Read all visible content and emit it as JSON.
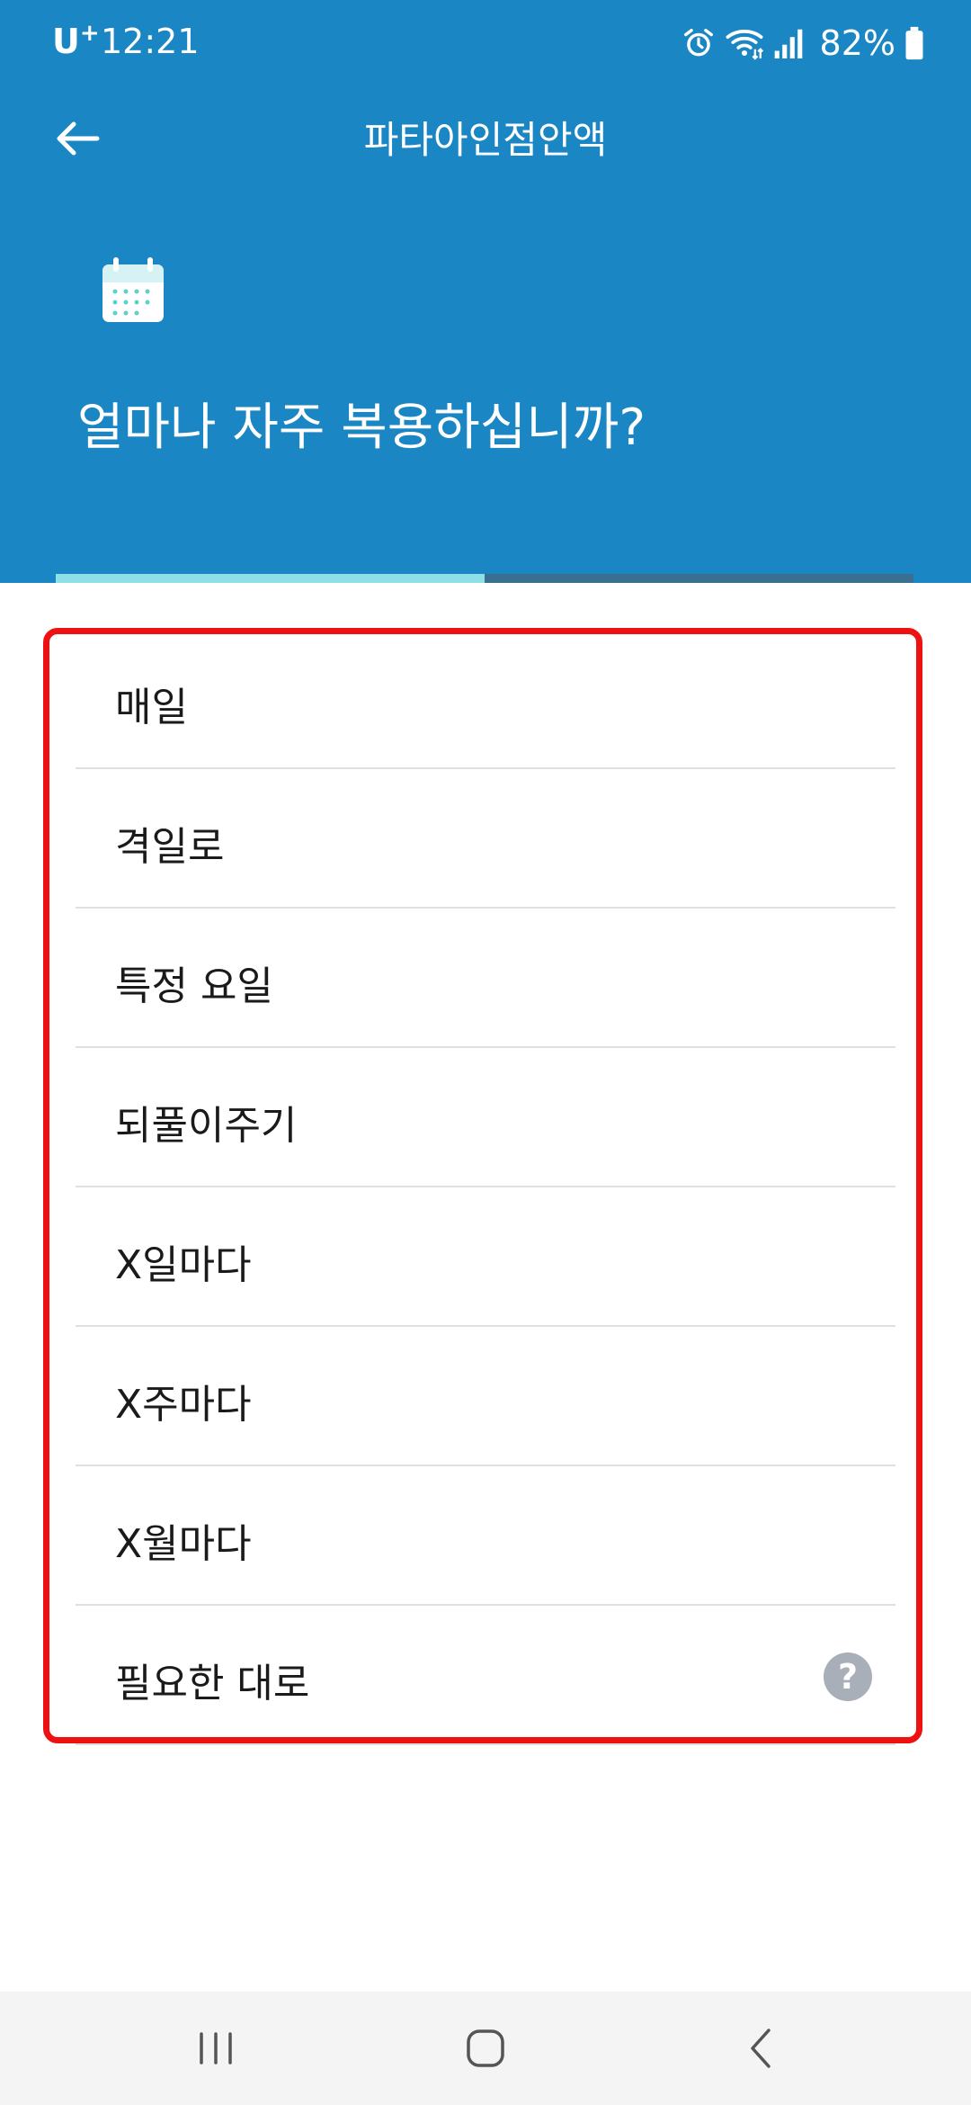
{
  "status_bar": {
    "carrier": "U",
    "carrier_plus": "+",
    "time": "12:21",
    "battery": "82%",
    "icons": [
      "alarm-icon",
      "wifi-icon",
      "signal-icon",
      "battery-icon"
    ]
  },
  "app_bar": {
    "back_icon": "arrow-left-icon",
    "title": "파타아인점안액"
  },
  "header": {
    "icon": "calendar-icon",
    "question": "얼마나 자주 복용하십니까?",
    "progress": 0.5
  },
  "options": [
    {
      "label": "매일"
    },
    {
      "label": "격일로"
    },
    {
      "label": "특정 요일"
    },
    {
      "label": "되풀이주기"
    },
    {
      "label": "X일마다"
    },
    {
      "label": "X주마다"
    },
    {
      "label": "X월마다"
    },
    {
      "label": "필요한 대로",
      "help": "?"
    }
  ],
  "nav_bar": {
    "icons": [
      "recent-apps-icon",
      "home-icon",
      "back-icon"
    ]
  },
  "colors": {
    "header_bg": "#1a86c4",
    "progress_fill": "#8fdfe6",
    "highlight_border": "#ee1111"
  }
}
